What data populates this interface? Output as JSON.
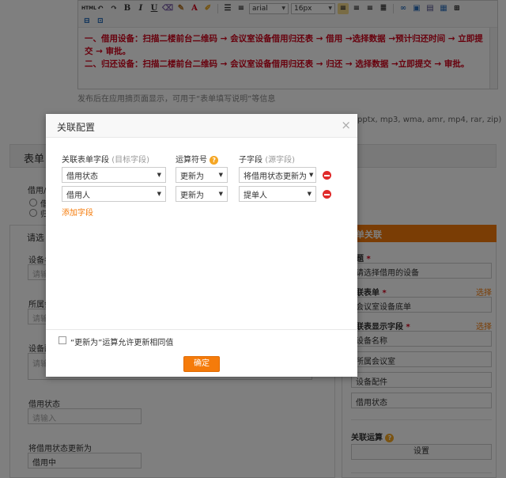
{
  "editor": {
    "toolbar_row1": {
      "html_label": "HTML",
      "bold": "B",
      "italic": "I",
      "underline": "U",
      "font_family": "arial",
      "font_size": "16px"
    },
    "content_lines": [
      "一、借用设备：扫描二楼前台二维码 → 会议室设备借用归还表 → 借用 →选择数据 →预计归还时间 → 立即提交 → 审批。",
      "二、归还设备：扫描二楼前台二维码 → 会议室设备借用归还表 → 归还 → 选择数据 →立即提交 → 审批。"
    ]
  },
  "hint_text": "发布后在应用摘页面显示，可用于“表单填写说明”等信息",
  "attachment_types": "pptx, mp3, wma, amr, mp4, rar, zip)",
  "background": {
    "section_title": "表单",
    "borrow_label": "借用/",
    "radio1": "借",
    "radio2": "归",
    "left_panel": {
      "title": "请选",
      "field1_label": "设备名",
      "field1_placeholder": "请输",
      "field2_label": "所属会",
      "field2_placeholder": "请输",
      "field3_label": "设备配",
      "field3_placeholder": "请输",
      "field4_label": "借用状态",
      "field4_placeholder": "请输入",
      "field5_label": "将借用状态更新为",
      "field5_value": "借用中"
    },
    "right_panel": {
      "header": "单关联",
      "title_label": "题",
      "title_value": "请选择借用的设备",
      "form_label": "联表单",
      "form_value": "会议室设备底单",
      "form_link": "选择",
      "display_label": "联表显示字段",
      "display_link": "选择",
      "display_fields": [
        "设备名称",
        "所属会议室",
        "设备配件",
        "借用状态"
      ],
      "calc_label": "关联运算",
      "settings_button": "设置"
    }
  },
  "modal": {
    "title": "关联配置",
    "close": "×",
    "col_target": "关联表单字段",
    "col_target_sub": "(目标字段)",
    "col_operator": "运算符号",
    "col_source": "子字段",
    "col_source_sub": "(源字段)",
    "rows": [
      {
        "target": "借用状态",
        "operator": "更新为",
        "source": "将借用状态更新为"
      },
      {
        "target": "借用人",
        "operator": "更新为",
        "source": "提单人"
      }
    ],
    "add_field": "添加字段",
    "checkbox_label": "“更新为”运算允许更新相同值",
    "confirm": "确定"
  }
}
